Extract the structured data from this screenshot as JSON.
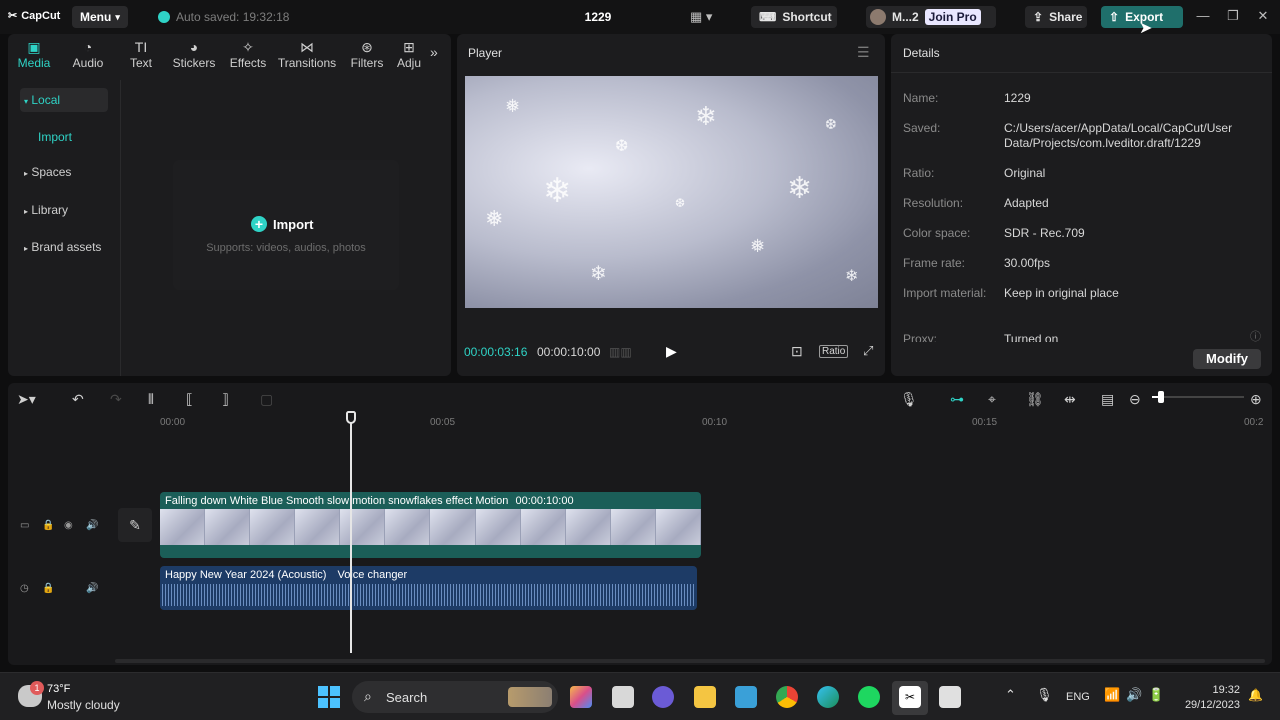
{
  "titlebar": {
    "logo": "CapCut",
    "menu_label": "Menu",
    "autosave": "Auto saved: 19:32:18",
    "project_title": "1229",
    "shortcut_label": "Shortcut",
    "user_label": "M...2",
    "join_pro_label": "Join Pro",
    "share_label": "Share",
    "export_label": "Export"
  },
  "media_tabs": [
    {
      "label": "Media",
      "icon": "media-icon"
    },
    {
      "label": "Audio",
      "icon": "audio-icon"
    },
    {
      "label": "Text",
      "icon": "text-icon"
    },
    {
      "label": "Stickers",
      "icon": "stickers-icon"
    },
    {
      "label": "Effects",
      "icon": "effects-icon"
    },
    {
      "label": "Transitions",
      "icon": "transitions-icon"
    },
    {
      "label": "Filters",
      "icon": "filters-icon"
    },
    {
      "label": "Adju",
      "icon": "adjust-icon"
    }
  ],
  "sidebar": {
    "local": "Local",
    "import": "Import",
    "spaces": "Spaces",
    "library": "Library",
    "brand_assets": "Brand assets"
  },
  "import_box": {
    "title": "Import",
    "subtitle": "Supports: videos, audios, photos"
  },
  "player": {
    "title": "Player",
    "current_time": "00:00:03:16",
    "total_time": "00:00:10:00",
    "ratio_label": "Ratio"
  },
  "details": {
    "title": "Details",
    "rows": [
      {
        "label": "Name:",
        "value": "1229"
      },
      {
        "label": "Saved:",
        "value": "C:/Users/acer/AppData/Local/CapCut/User Data/Projects/com.lveditor.draft/1229"
      },
      {
        "label": "Ratio:",
        "value": "Original"
      },
      {
        "label": "Resolution:",
        "value": "Adapted"
      },
      {
        "label": "Color space:",
        "value": "SDR - Rec.709"
      },
      {
        "label": "Frame rate:",
        "value": "30.00fps"
      },
      {
        "label": "Import material:",
        "value": "Keep in original place"
      },
      {
        "label": "Proxy:",
        "value": "Turned on"
      }
    ],
    "modify_label": "Modify"
  },
  "timeline": {
    "ruler": [
      "00:00",
      "00:05",
      "00:10",
      "00:15",
      "00:2"
    ],
    "video_clip_title": "Falling down White Blue Smooth slow motion snowflakes effect Motion",
    "video_clip_duration": "00:00:10:00",
    "audio_clip_title": "Happy New Year 2024 (Acoustic)",
    "audio_clip_effect": "Voice changer"
  },
  "taskbar": {
    "weather_temp": "73°F",
    "weather_desc": "Mostly cloudy",
    "weather_badge": "1",
    "search_label": "Search",
    "language": "ENG",
    "time": "19:32",
    "date": "29/12/2023"
  },
  "colors": {
    "accent": "#2fd3c6",
    "export_bg": "#1f6f6b",
    "video_track": "#1b5e58",
    "audio_track": "#1d3b66"
  }
}
